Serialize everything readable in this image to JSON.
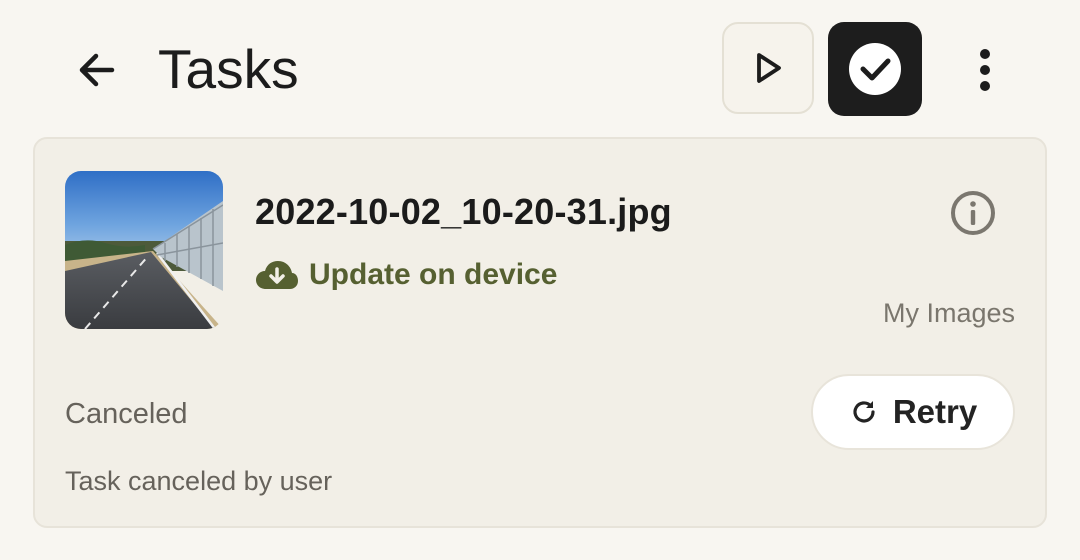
{
  "appbar": {
    "title": "Tasks",
    "icons": [
      "arrow-back-icon",
      "play-icon",
      "check-circle-icon",
      "more-vert-icon"
    ],
    "check_button_bg": "#1d1d1d"
  },
  "task": {
    "filename": "2022-10-02_10-20-31.jpg",
    "status": "Update on device",
    "status_color": "#566031",
    "album": "My Images",
    "state": "Canceled",
    "reason": "Task canceled by user",
    "retry_label": "Retry",
    "icons": [
      "thumbnail-image",
      "info-icon",
      "cloud-download-icon",
      "refresh-icon"
    ]
  }
}
